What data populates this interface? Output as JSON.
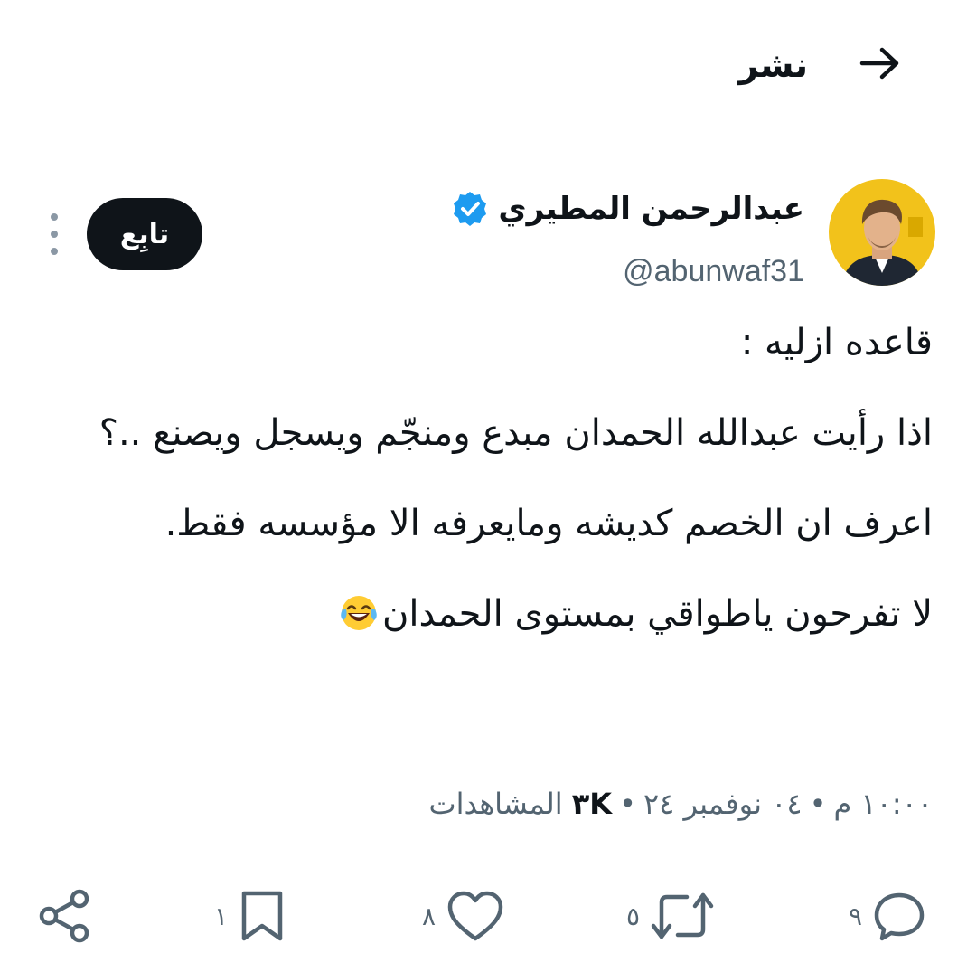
{
  "header": {
    "back_icon": "arrow-right-icon",
    "title": "نشر"
  },
  "author": {
    "name": "عبدالرحمن المطيري",
    "handle": "@abunwaf31",
    "verified_icon": "verified-badge-icon",
    "verified_color": "#1d9bf0",
    "avatar_bg": "#f2c21b"
  },
  "follow_button": {
    "label": "تابِع"
  },
  "more_icon": "more-vertical-icon",
  "tweet": {
    "line1": "قاعده ازليه :",
    "line2": "اذا رأيت عبدالله الحمدان مبدع ومنجّم ويسجل ويصنع ..؟",
    "line3": "اعرف ان الخصم كديشه ومايعرفه الا مؤسسه فقط.",
    "line4": "لا تفرحون ياطواقي بمستوى الحمدان",
    "emoji": "laughing-tears-emoji"
  },
  "meta": {
    "time": "١٠:٠٠ م",
    "date": "٠٤ نوفمبر ٢٤",
    "views_count": "٣K",
    "views_label": "المشاهدات",
    "separator": "•"
  },
  "actions": {
    "reply": {
      "icon": "reply-icon",
      "count": "٩"
    },
    "repost": {
      "icon": "repost-icon",
      "count": "٥"
    },
    "like": {
      "icon": "heart-icon",
      "count": "٨"
    },
    "bookmark": {
      "icon": "bookmark-icon",
      "count": "١"
    },
    "share": {
      "icon": "share-icon"
    }
  }
}
